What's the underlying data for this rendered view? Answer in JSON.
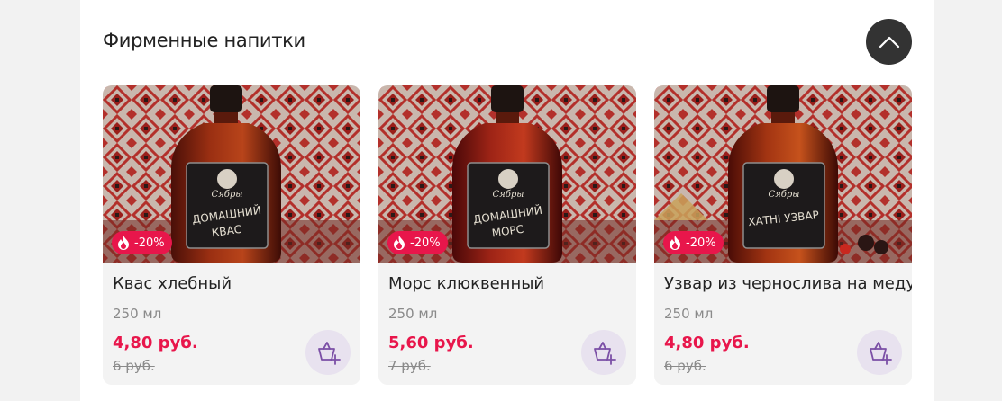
{
  "section": {
    "title": "Фирменные напитки",
    "collapse_icon": "chevron-up-icon"
  },
  "colors": {
    "accent": "#e8164b",
    "cart_bg": "#e8e2ef",
    "cart_icon": "#7b4fa6",
    "collapse_bg": "#333333"
  },
  "products": [
    {
      "name": "Квас хлебный",
      "volume": "250 мл",
      "price": "4,80 руб.",
      "old_price": "6 руб.",
      "discount": "-20%",
      "label_brand": "Сябры",
      "label_line1": "ДОМАШНИЙ",
      "label_line2": "КВАС"
    },
    {
      "name": "Морс клюквенный",
      "volume": "250 мл",
      "price": "5,60 руб.",
      "old_price": "7 руб.",
      "discount": "-20%",
      "label_brand": "Сябры",
      "label_line1": "ДОМАШНИЙ",
      "label_line2": "МОРС"
    },
    {
      "name": "Узвар из чернослива на меду",
      "volume": "250 мл",
      "price": "4,80 руб.",
      "old_price": "6 руб.",
      "discount": "-20%",
      "label_brand": "Сябры",
      "label_line1": "ХАТНI УЗВАР",
      "label_line2": ""
    }
  ]
}
